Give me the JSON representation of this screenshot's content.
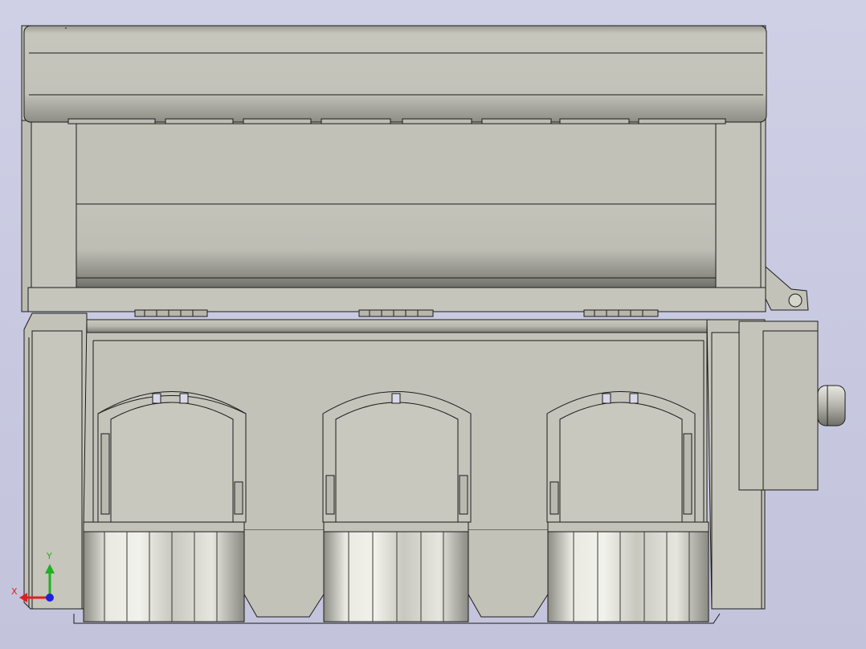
{
  "viewport": {
    "background_color": "#cacbe2",
    "model_color": "#c2c2b9",
    "edge_color": "#1c1c1c"
  },
  "triad": {
    "x_label": "X",
    "y_label": "Y",
    "x_color": "#e02020",
    "y_color": "#20b020",
    "z_color": "#2020e0"
  }
}
